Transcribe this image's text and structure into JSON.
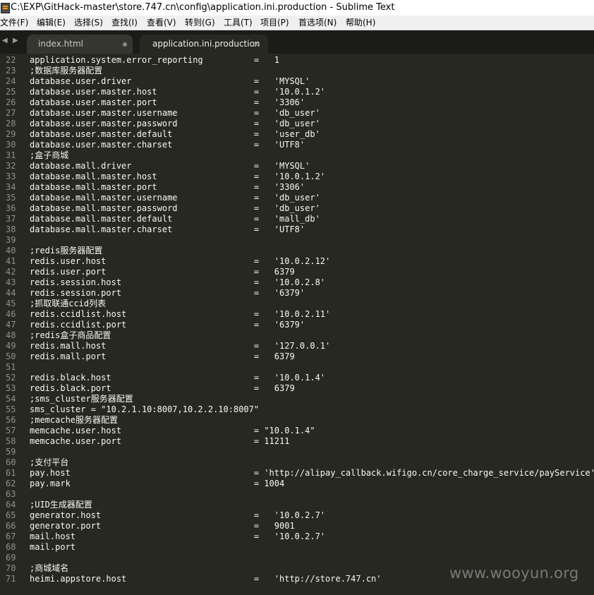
{
  "window": {
    "title": "C:\\EXP\\GitHack-master\\store.747.cn\\config\\application.ini.production - Sublime Text"
  },
  "menu": [
    "文件(F)",
    "编辑(E)",
    "选择(S)",
    "查找(I)",
    "查看(V)",
    "转到(G)",
    "工具(T)",
    "项目(P)",
    "首选项(N)",
    "帮助(H)"
  ],
  "tabs": [
    {
      "label": "index.html",
      "active": false,
      "dirty": true
    },
    {
      "label": "application.ini.production",
      "active": true,
      "close": "×"
    }
  ],
  "tab_nav": {
    "left": "◀",
    "right": "▶"
  },
  "editor": {
    "lines": [
      {
        "num": "22",
        "text": "application.system.error_reporting          =   1"
      },
      {
        "num": "23",
        "text": ";数据库服务器配置"
      },
      {
        "num": "24",
        "text": "database.user.driver                        =   'MYSQL'"
      },
      {
        "num": "25",
        "text": "database.user.master.host                   =   '10.0.1.2'"
      },
      {
        "num": "26",
        "text": "database.user.master.port                   =   '3306'"
      },
      {
        "num": "27",
        "text": "database.user.master.username               =   'db_user'"
      },
      {
        "num": "28",
        "text": "database.user.master.password               =   'db_user'"
      },
      {
        "num": "29",
        "text": "database.user.master.default                =   'user_db'"
      },
      {
        "num": "30",
        "text": "database.user.master.charset                =   'UTF8'"
      },
      {
        "num": "31",
        "text": ";盒子商城"
      },
      {
        "num": "32",
        "text": "database.mall.driver                        =   'MYSQL'"
      },
      {
        "num": "33",
        "text": "database.mall.master.host                   =   '10.0.1.2'"
      },
      {
        "num": "34",
        "text": "database.mall.master.port                   =   '3306'"
      },
      {
        "num": "35",
        "text": "database.mall.master.username               =   'db_user'"
      },
      {
        "num": "36",
        "text": "database.mall.master.password               =   'db_user'"
      },
      {
        "num": "37",
        "text": "database.mall.master.default                =   'mall_db'"
      },
      {
        "num": "38",
        "text": "database.mall.master.charset                =   'UTF8'"
      },
      {
        "num": "39",
        "text": ""
      },
      {
        "num": "40",
        "text": ";redis服务器配置"
      },
      {
        "num": "41",
        "text": "redis.user.host                             =   '10.0.2.12'"
      },
      {
        "num": "42",
        "text": "redis.user.port                             =   6379"
      },
      {
        "num": "43",
        "text": "redis.session.host                          =   '10.0.2.8'"
      },
      {
        "num": "44",
        "text": "redis.session.port                          =   '6379'"
      },
      {
        "num": "45",
        "text": ";抓取联通ccid列表"
      },
      {
        "num": "46",
        "text": "redis.ccidlist.host                         =   '10.0.2.11'"
      },
      {
        "num": "47",
        "text": "redis.ccidlist.port                         =   '6379'"
      },
      {
        "num": "48",
        "text": ";redis盒子商品配置"
      },
      {
        "num": "49",
        "text": "redis.mall.host                             =   '127.0.0.1'"
      },
      {
        "num": "50",
        "text": "redis.mall.port                             =   6379"
      },
      {
        "num": "51",
        "text": ""
      },
      {
        "num": "52",
        "text": "redis.black.host                            =   '10.0.1.4'"
      },
      {
        "num": "53",
        "text": "redis.black.port                            =   6379"
      },
      {
        "num": "54",
        "text": ";sms_cluster服务器配置"
      },
      {
        "num": "55",
        "text": "sms_cluster = \"10.2.1.10:8007,10.2.2.10:8007\""
      },
      {
        "num": "56",
        "text": ";memcache服务器配置"
      },
      {
        "num": "57",
        "text": "memcache.user.host                          = \"10.0.1.4\""
      },
      {
        "num": "58",
        "text": "memcache.user.port                          = 11211"
      },
      {
        "num": "59",
        "text": ""
      },
      {
        "num": "60",
        "text": ";支付平台"
      },
      {
        "num": "61",
        "text": "pay.host                                    = 'http://alipay_callback.wifigo.cn/core_charge_service/payService'"
      },
      {
        "num": "62",
        "text": "pay.mark                                    = 1004"
      },
      {
        "num": "63",
        "text": ""
      },
      {
        "num": "64",
        "text": ";UID生成器配置"
      },
      {
        "num": "65",
        "text": "generator.host                              =   '10.0.2.7'"
      },
      {
        "num": "66",
        "text": "generator.port                              =   9001"
      },
      {
        "num": "67",
        "text": "mail.host                                   =   '10.0.2.7'"
      },
      {
        "num": "68",
        "text": "mail.port"
      },
      {
        "num": "69",
        "text": ""
      },
      {
        "num": "70",
        "text": ";商城域名"
      },
      {
        "num": "71",
        "text": "heimi.appstore.host                         =   'http://store.747.cn'"
      }
    ]
  },
  "watermark": "www.wooyun.org"
}
